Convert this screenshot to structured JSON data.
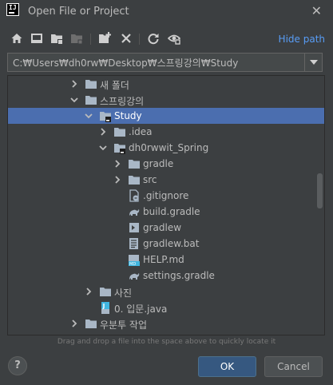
{
  "window": {
    "title": "Open File or Project",
    "app_logo": "IJ"
  },
  "toolbar": {
    "icons": [
      "home-icon",
      "desktop-icon",
      "project-folder-icon",
      "module-folder-icon",
      "new-folder-icon",
      "delete-icon",
      "refresh-icon",
      "show-hidden-icon"
    ],
    "hide_path_label": "Hide path"
  },
  "path": {
    "value": "C:₩Users₩dh0rw₩Desktop₩스프링강의₩Study"
  },
  "tree": {
    "rows": [
      {
        "label": "새 폴더",
        "icon": "folder-icon",
        "expanded": false
      },
      {
        "label": "스프링강의",
        "icon": "folder-icon",
        "expanded": true
      },
      {
        "label": "Study",
        "icon": "project-folder-icon",
        "expanded": true,
        "selected": true
      },
      {
        "label": ".idea",
        "icon": "folder-icon",
        "expanded": false
      },
      {
        "label": "dh0rwwit_Spring",
        "icon": "project-folder-icon",
        "expanded": true
      },
      {
        "label": "gradle",
        "icon": "folder-icon",
        "expanded": false
      },
      {
        "label": "src",
        "icon": "folder-icon",
        "expanded": false
      },
      {
        "label": ".gitignore",
        "icon": "gitignore-file-icon"
      },
      {
        "label": "build.gradle",
        "icon": "gradle-file-icon"
      },
      {
        "label": "gradlew",
        "icon": "script-file-icon"
      },
      {
        "label": "gradlew.bat",
        "icon": "text-file-icon"
      },
      {
        "label": "HELP.md",
        "icon": "markdown-file-icon"
      },
      {
        "label": "settings.gradle",
        "icon": "gradle-file-icon"
      },
      {
        "label": "사진",
        "icon": "folder-icon",
        "expanded": false
      },
      {
        "label": "0. 입문.java",
        "icon": "java-file-icon"
      },
      {
        "label": "우분투 작업",
        "icon": "folder-icon",
        "expanded": false
      }
    ]
  },
  "hint": "Drag and drop a file into the space above to quickly locate it",
  "buttons": {
    "help": "?",
    "ok": "OK",
    "cancel": "Cancel"
  },
  "colors": {
    "background": "#3c3f41",
    "selection": "#4b6eaf",
    "link": "#589df6",
    "ok_button": "#365880"
  }
}
